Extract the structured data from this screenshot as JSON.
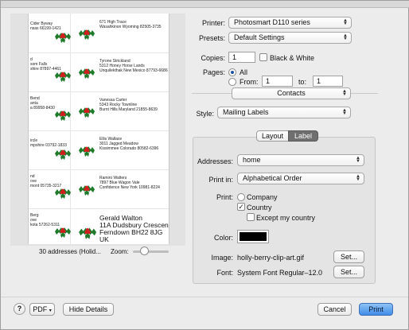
{
  "preview": {
    "left_labels": [
      {
        "lines": [
          "Cider Byway",
          "nsas 66199-1421"
        ]
      },
      {
        "lines": [
          "d",
          "som Falls",
          "shire 87897-4461"
        ]
      },
      {
        "lines": [
          "Bend",
          "anta",
          "a 89958-8430"
        ]
      },
      {
        "lines": [
          "ircle",
          "mpshire 03792-1833"
        ]
      },
      {
        "lines": [
          "nd",
          "ove",
          "mont 05735-3217"
        ]
      },
      {
        "lines": [
          "Berg",
          "ove",
          "kota 57262-5311"
        ]
      }
    ],
    "right_labels": [
      {
        "lines": [
          "671 High Trace",
          "Wasahkinon Wyoming 82505-3735"
        ],
        "big": false
      },
      {
        "lines": [
          "Tyrone Strickland",
          "5312 Honey Horse Lands",
          "Unquilekthak New Mexico 87793-6686"
        ],
        "big": false
      },
      {
        "lines": [
          "Vanessa Carter",
          "5343 Rocky Townline",
          "Burnt Hills Maryland 21855-8639"
        ],
        "big": false
      },
      {
        "lines": [
          "Ellis Wallace",
          "3011 Jagged Meadow",
          "Kissimmee Colorado 80582-6396"
        ],
        "big": false
      },
      {
        "lines": [
          "Ramiro Walters",
          "7897 Blue Wagon Vale",
          "Confidence New York 10981-8224"
        ],
        "big": false
      },
      {
        "lines": [
          "Gerald Walton",
          "11A Dudsbury Crescent",
          "Ferndown  BH22 8JG",
          "UK"
        ],
        "big": true
      }
    ],
    "count_text": "30 addresses (Holid...",
    "zoom_label": "Zoom:",
    "zoom_level": 0.25
  },
  "printer": {
    "label": "Printer:",
    "value": "Photosmart D110 series"
  },
  "presets": {
    "label": "Presets:",
    "value": "Default Settings"
  },
  "copies": {
    "label": "Copies:",
    "value": "1",
    "bw_label": "Black & White",
    "bw_checked": false
  },
  "pages": {
    "label": "Pages:",
    "all_label": "All",
    "from_label": "From:",
    "from_value": "1",
    "to_label": "to:",
    "to_value": "1",
    "selected": "All"
  },
  "section_popup": "Contacts",
  "style": {
    "label": "Style:",
    "value": "Mailing Labels"
  },
  "tabs": [
    {
      "label": "Layout",
      "selected": false
    },
    {
      "label": "Label",
      "selected": true
    }
  ],
  "addresses": {
    "label": "Addresses:",
    "value": "home"
  },
  "print_in": {
    "label": "Print in:",
    "value": "Alphabetical Order"
  },
  "print_opts": {
    "label": "Print:",
    "company": {
      "label": "Company",
      "checked": false
    },
    "country": {
      "label": "Country",
      "checked": true
    },
    "except": {
      "label": "Except my country",
      "checked": false
    }
  },
  "color": {
    "label": "Color:",
    "value": "#000000"
  },
  "image": {
    "label": "Image:",
    "value": "holly-berry-clip-art.gif",
    "set_label": "Set..."
  },
  "font": {
    "label": "Font:",
    "value": "System Font Regular‒12.0",
    "set_label": "Set..."
  },
  "footer": {
    "help_glyph": "?",
    "pdf_label": "PDF",
    "hide_details_label": "Hide Details",
    "cancel_label": "Cancel",
    "print_label": "Print"
  },
  "colors": {
    "holly_leaf": "#1f7a2a",
    "holly_berry": "#d11f1f",
    "print_button": "#3f8ce8"
  }
}
